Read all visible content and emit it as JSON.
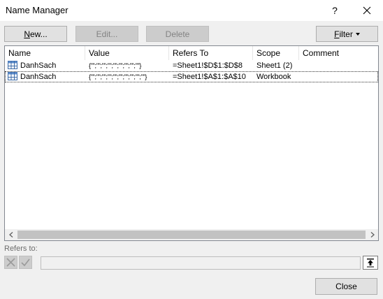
{
  "window": {
    "title": "Name Manager",
    "help_label": "?"
  },
  "toolbar": {
    "new_label": "New...",
    "new_accel": "N",
    "new_rest": "ew...",
    "edit_label": "Edit...",
    "delete_label": "Delete",
    "filter_label": "Filter",
    "filter_accel": "F",
    "filter_rest": "ilter"
  },
  "table": {
    "columns": [
      "Name",
      "Value",
      "Refers To",
      "Scope",
      "Comment"
    ],
    "rows": [
      {
        "name": "DanhSach",
        "value": "{\"\";\"\";\"\";\"\";\"\";\"\";\"\";\"\";\"\"}",
        "refers_to": "=Sheet1!$D$1:$D$8",
        "scope": "Sheet1 (2)",
        "comment": ""
      },
      {
        "name": "DanhSach",
        "value": "{\"\";\"\";\"\";\"\";\"\";\"\";\"\";\"\";\"\";\"\"}",
        "refers_to": "=Sheet1!$A$1:$A$10",
        "scope": "Workbook",
        "comment": ""
      }
    ]
  },
  "refers": {
    "label": "Refers to:",
    "value": ""
  },
  "footer": {
    "close_label": "Close"
  },
  "colors": {
    "background": "#f0f0f0",
    "disabled_text": "#838383",
    "list_border": "#828790"
  }
}
